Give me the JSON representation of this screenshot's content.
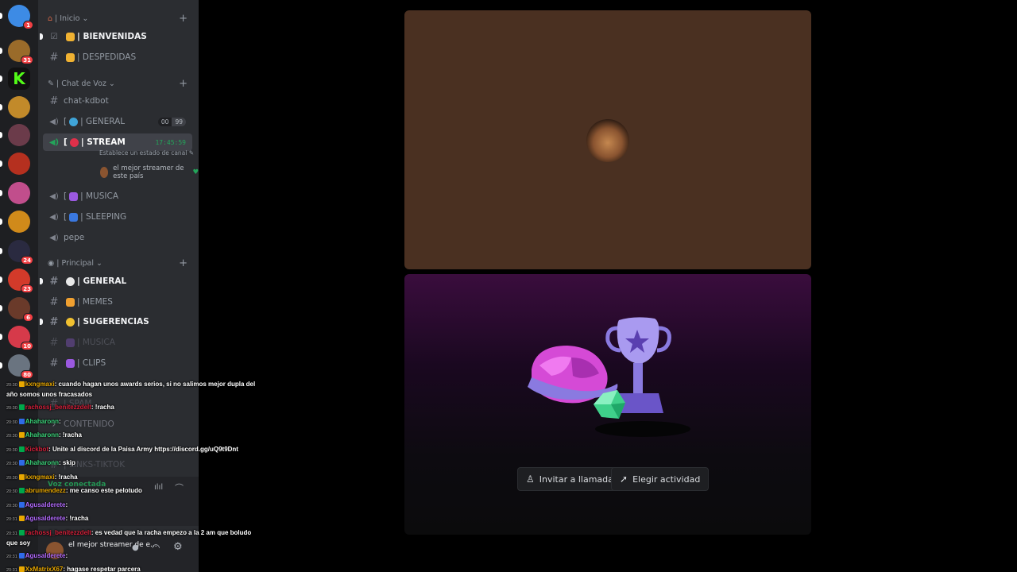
{
  "servers": [
    {
      "color": "#3d8be5",
      "badge": "1"
    },
    {
      "color": "#9a6b2a",
      "badge": "31"
    },
    {
      "color": "#111111",
      "badge": "",
      "letter": "K",
      "letter_color": "#53fc18"
    },
    {
      "color": "#c28a2a",
      "badge": ""
    },
    {
      "color": "#6b3b4a",
      "badge": ""
    },
    {
      "color": "#b5301f",
      "badge": ""
    },
    {
      "color": "#c14e8c",
      "badge": ""
    },
    {
      "color": "#d08a1a",
      "badge": ""
    },
    {
      "color": "#2a2a40",
      "badge": "24"
    },
    {
      "color": "#d33a2a",
      "badge": "23"
    },
    {
      "color": "#6a3a2a",
      "badge": "6"
    },
    {
      "color": "#d63a4a",
      "badge": "10"
    },
    {
      "color": "#6a7480",
      "badge": "80"
    }
  ],
  "sidebar": {
    "cat_inicio": "| Inicio",
    "ch_bienvenidas": "| BIENVENIDAS",
    "ch_despedidas": "| DESPEDIDAS",
    "cat_voz": "| Chat de Voz",
    "ch_chatkdbot": "chat-kdbot",
    "ch_general_voice": "| GENERAL",
    "general_pill_a": "00",
    "general_pill_b": "99",
    "ch_stream": "| STREAM",
    "stream_time": "17:45:59",
    "stream_status": "Establece un estado de canal",
    "stream_user": "el mejor streamer de este país",
    "ch_musica_voice": "| MUSICA",
    "ch_sleeping": "| SLEEPING",
    "ch_pepe": "pepe",
    "cat_principal": "| Principal",
    "ch_general_text": "| GENERAL",
    "ch_memes": "| MEMES",
    "ch_sugerencias": "| SUGERENCIAS",
    "ch_musica_text": "| MUSICA",
    "ch_clips": "| CLIPS",
    "ch_spam": "| SPAM",
    "ch_contenido": "CONTENIDO",
    "ch_links": "| LINKS-TIKTOK",
    "voice_connected": "Voz conectada",
    "footer_user": "el mejor streamer de e..."
  },
  "stage": {
    "invite_label": "Invitar a llamada",
    "activity_label": "Elegir actividad"
  },
  "chat": [
    {
      "time": "20:30",
      "user": "kxngmaxi",
      "color": "#e9a800",
      "text": ": cuando hagan unos awards serios, si no salimos mejor dupla del año somos unos fracasados",
      "wrap": true
    },
    {
      "time": "20:30",
      "user": "rachossj_benitezzdelt",
      "color": "#d61f3a",
      "text": ": !racha"
    },
    {
      "time": "20:30",
      "user": "Ahaharonn",
      "color": "#3bd37a",
      "text": ": "
    },
    {
      "time": "20:30",
      "user": "Ahaharonn",
      "color": "#3bd37a",
      "text": ": !racha"
    },
    {
      "time": "20:30",
      "user": "Kickbot",
      "color": "#d61f3a",
      "text": ": Unite al discord de la Paisa Army https://discord.gg/uQ9t9Dnt"
    },
    {
      "time": "20:30",
      "user": "Ahaharonn",
      "color": "#3bd37a",
      "text": ": skip"
    },
    {
      "time": "20:30",
      "user": "kxngmaxi",
      "color": "#e9a800",
      "text": ": !racha"
    },
    {
      "time": "20:30",
      "user": "abrumendezz",
      "color": "#e9a800",
      "text": ": me canso este pelotudo"
    },
    {
      "time": "20:30",
      "user": "Agusalderete",
      "color": "#b36bff",
      "text": ": "
    },
    {
      "time": "20:31",
      "user": "Agusalderete",
      "color": "#b36bff",
      "text": ": !racha"
    },
    {
      "time": "20:31",
      "user": "rachossj_benitezzdelt",
      "color": "#d61f3a",
      "text": ": es vedad que la racha empezo a la 2 am que boludo que soy",
      "wrap": true
    },
    {
      "time": "20:31",
      "user": "Agusalderete",
      "color": "#b36bff",
      "text": ": "
    },
    {
      "time": "20:31",
      "user": "XxMatrixX67",
      "color": "#e9a800",
      "text": ": hagase respetar parcera"
    },
    {
      "time": "20:32",
      "user": "Agusalderete",
      "color": "#b36bff",
      "text": ": "
    }
  ]
}
